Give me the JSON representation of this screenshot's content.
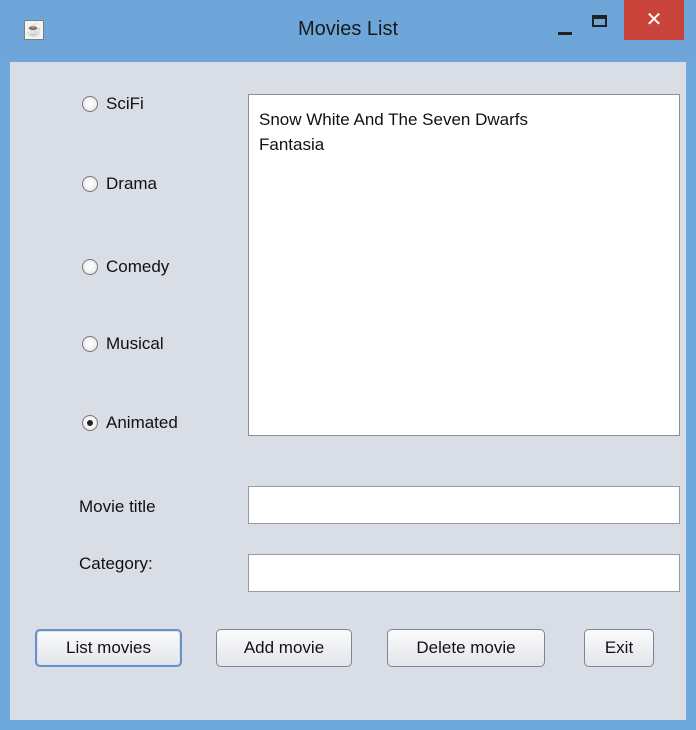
{
  "window": {
    "title": "Movies List",
    "close_glyph": "✕"
  },
  "categories": [
    {
      "label": "SciFi",
      "checked": false
    },
    {
      "label": "Drama",
      "checked": false
    },
    {
      "label": "Comedy",
      "checked": false
    },
    {
      "label": "Musical",
      "checked": false
    },
    {
      "label": "Animated",
      "checked": true
    }
  ],
  "movie_list": [
    "Snow White And The Seven Dwarfs",
    "Fantasia"
  ],
  "form": {
    "title_label": "Movie title",
    "title_value": "",
    "category_label": "Category:",
    "category_value": ""
  },
  "buttons": {
    "list": "List movies",
    "add": "Add movie",
    "delete": "Delete movie",
    "exit": "Exit"
  }
}
